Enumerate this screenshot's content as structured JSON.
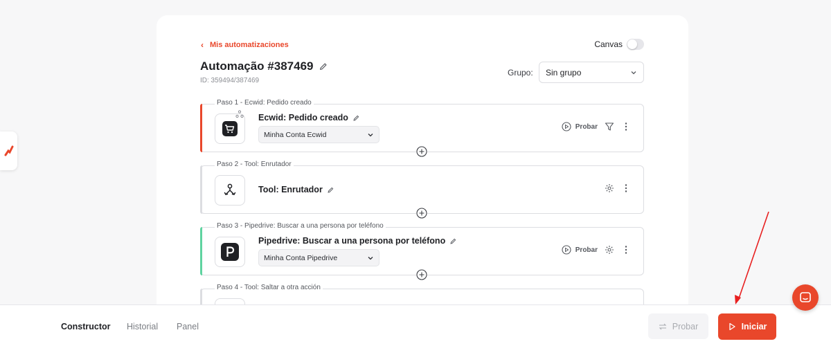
{
  "header": {
    "back_label": "Mis automatizaciones",
    "title": "Automação #387469",
    "id_text": "ID: 359494/387469",
    "canvas_label": "Canvas",
    "group_label": "Grupo:",
    "group_value": "Sin grupo"
  },
  "steps": [
    {
      "label": "Paso 1 - Ecwid: Pedido creado",
      "name": "Ecwid: Pedido creado",
      "account": "Minha Conta Ecwid",
      "test_label": "Probar",
      "accent": "#e9472b"
    },
    {
      "label": "Paso 2 - Tool: Enrutador",
      "name": "Tool: Enrutador",
      "accent": "#dcdde1"
    },
    {
      "label": "Paso 3 - Pipedrive: Buscar a una persona por teléfono",
      "name": "Pipedrive: Buscar a una persona por teléfono",
      "account": "Minha Conta Pipedrive",
      "test_label": "Probar",
      "accent": "#5fd3a0"
    },
    {
      "label": "Paso 4 - Tool: Saltar a otra acción",
      "accent": "#dcdde1"
    }
  ],
  "bottom_bar": {
    "tabs": [
      "Constructor",
      "Historial",
      "Panel"
    ],
    "test_button": "Probar",
    "start_button": "Iniciar"
  },
  "colors": {
    "brand": "#e9472b",
    "success_accent": "#5fd3a0"
  },
  "icons": {
    "back": "chevron-left-icon",
    "edit": "pencil-icon",
    "dropdown": "chevron-down-icon",
    "ecwid": "shopping-cart-icon",
    "router": "router-branch-icon",
    "pipedrive": "pipedrive-p-icon",
    "test": "play-circle-icon",
    "filter": "filter-icon",
    "settings": "gear-icon",
    "more": "more-vertical-icon",
    "add": "plus-circle-icon",
    "chat": "chat-icon"
  }
}
